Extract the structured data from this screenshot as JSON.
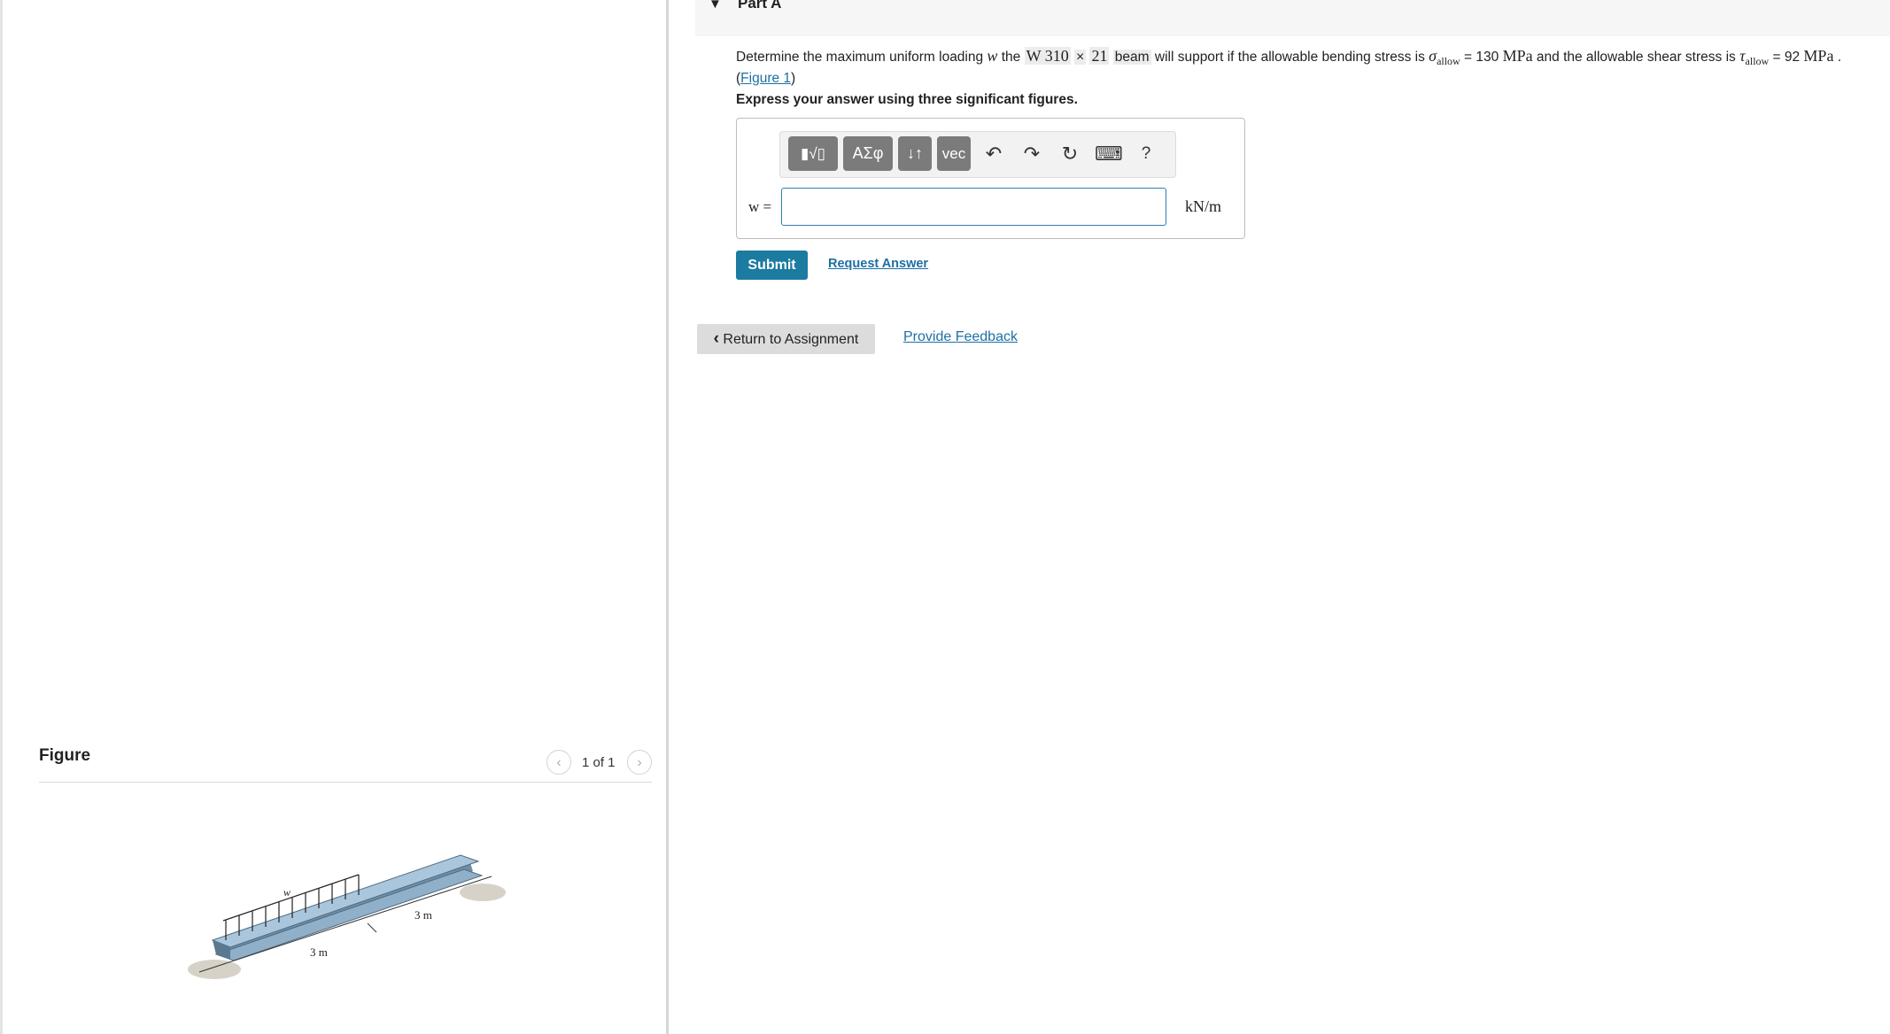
{
  "part": {
    "caret_icon": "caret-down-icon",
    "title": "Part A"
  },
  "question": {
    "t1": "Determine the maximum uniform loading ",
    "var_w": "w",
    "t2": " the ",
    "beam_designation_a": "W 310",
    "times": "×",
    "beam_designation_b": "21",
    "t3": "beam",
    "t4": " will support if the allowable bending stress is ",
    "sigma": "σ",
    "allow_sub": "allow",
    "t5": " = 130 ",
    "mpa": "MPa",
    "t6": " and the allowable shear stress is ",
    "tau": "τ",
    "allow_sub2": "allow",
    "t7": " = 92 ",
    "mpa2": "MPa",
    "t8": " .",
    "open_paren": "(",
    "figure_link": "Figure 1",
    "close_paren": ")"
  },
  "instruction": "Express your answer using three significant figures.",
  "toolbar": {
    "templates_label": "▮√▯",
    "greek_label": "ΑΣφ",
    "arrows_label": "↓↑",
    "vec_label": "vec",
    "undo_icon": "↶",
    "redo_icon": "↷",
    "reset_icon": "↻",
    "keyboard_icon": "⌨",
    "help_label": "?"
  },
  "answer": {
    "label": "w =",
    "value": "",
    "unit": "kN/m"
  },
  "buttons": {
    "submit": "Submit",
    "request_answer": "Request Answer",
    "return": "Return to Assignment",
    "return_icon": "‹",
    "feedback": "Provide Feedback"
  },
  "figure": {
    "title": "Figure",
    "prev_icon": "‹",
    "next_icon": "›",
    "count": "1 of 1",
    "load_label": "w",
    "span_left": "3 m",
    "span_right": "3 m"
  },
  "colors": {
    "link": "#1d6fa5",
    "submit_bg": "#1b7ba0",
    "toolbar_btn": "#7b7b7b",
    "input_border": "#2e7fb5",
    "beam_top": "#a9c6dc",
    "beam_side": "#6f8fa8"
  }
}
